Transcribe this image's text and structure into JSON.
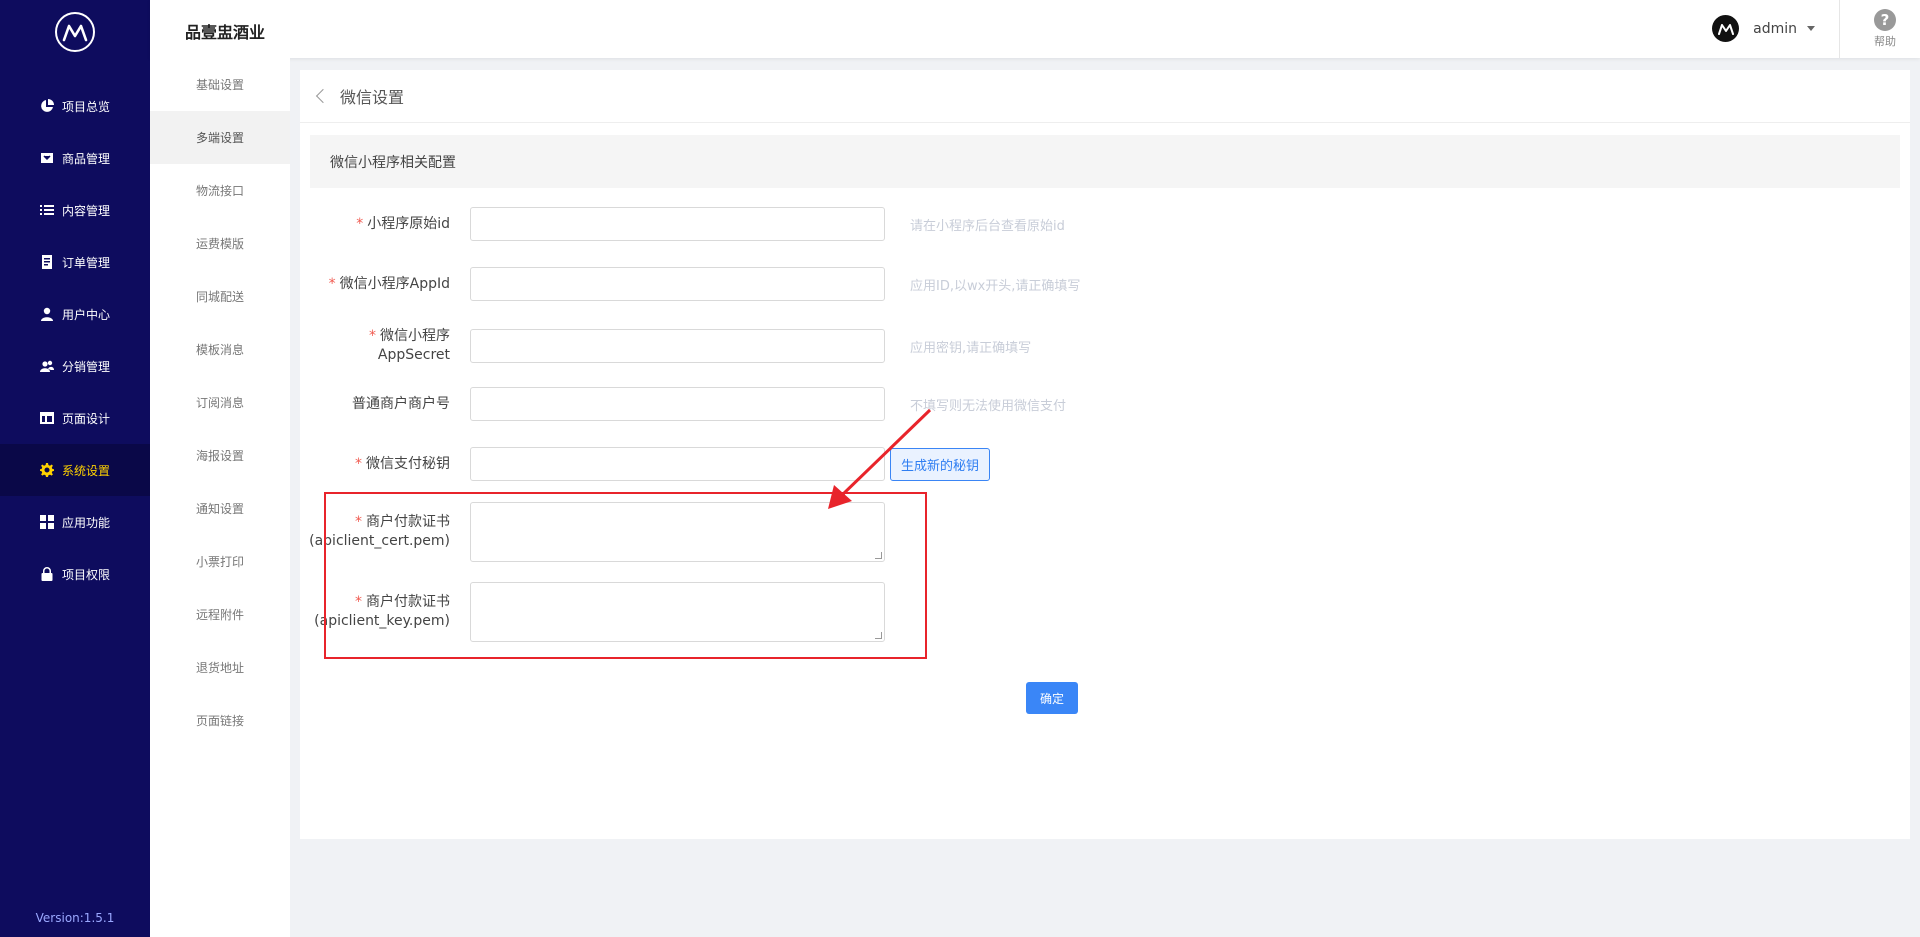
{
  "sidebar": {
    "items": [
      {
        "label": "项目总览",
        "icon": "pie-chart-icon"
      },
      {
        "label": "商品管理",
        "icon": "tag-icon"
      },
      {
        "label": "内容管理",
        "icon": "list-icon"
      },
      {
        "label": "订单管理",
        "icon": "document-icon"
      },
      {
        "label": "用户中心",
        "icon": "user-icon"
      },
      {
        "label": "分销管理",
        "icon": "users-icon"
      },
      {
        "label": "页面设计",
        "icon": "layout-icon"
      },
      {
        "label": "系统设置",
        "icon": "gear-icon",
        "active": true
      },
      {
        "label": "应用功能",
        "icon": "grid-icon"
      },
      {
        "label": "项目权限",
        "icon": "lock-icon"
      }
    ],
    "version": "Version:1.5.1"
  },
  "header": {
    "brand": "品壹盅酒业",
    "user": "admin",
    "help": "帮助",
    "help_glyph": "?"
  },
  "subnav": {
    "items": [
      "基础设置",
      "多端设置",
      "物流接口",
      "运费模版",
      "同城配送",
      "模板消息",
      "订阅消息",
      "海报设置",
      "通知设置",
      "小票打印",
      "远程附件",
      "退货地址",
      "页面链接"
    ],
    "active_index": 1
  },
  "page": {
    "title": "微信设置",
    "section": "微信小程序相关配置",
    "fields": {
      "original_id": {
        "label": "小程序原始id",
        "hint": "请在小程序后台查看原始id"
      },
      "appid": {
        "label": "微信小程序AppId",
        "hint": "应用ID,以wx开头,请正确填写"
      },
      "appsecret": {
        "label": "微信小程序AppSecret",
        "hint": "应用密钥,请正确填写"
      },
      "merchant_no": {
        "label": "普通商户商户号",
        "hint": "不填写则无法使用微信支付"
      },
      "pay_secret": {
        "label": "微信支付秘钥",
        "button": "生成新的秘钥"
      },
      "cert": {
        "label1": "商户付款证书",
        "label2": "(apiclient_cert.pem)"
      },
      "key": {
        "label1": "商户付款证书",
        "label2": "(apiclient_key.pem)"
      }
    },
    "required_mark": "*",
    "confirm": "确定"
  },
  "colors": {
    "sidebar_bg": "#0e0c5e",
    "active_text": "#ffd200",
    "primary": "#3a86f7",
    "annotation": "#e8242b"
  }
}
